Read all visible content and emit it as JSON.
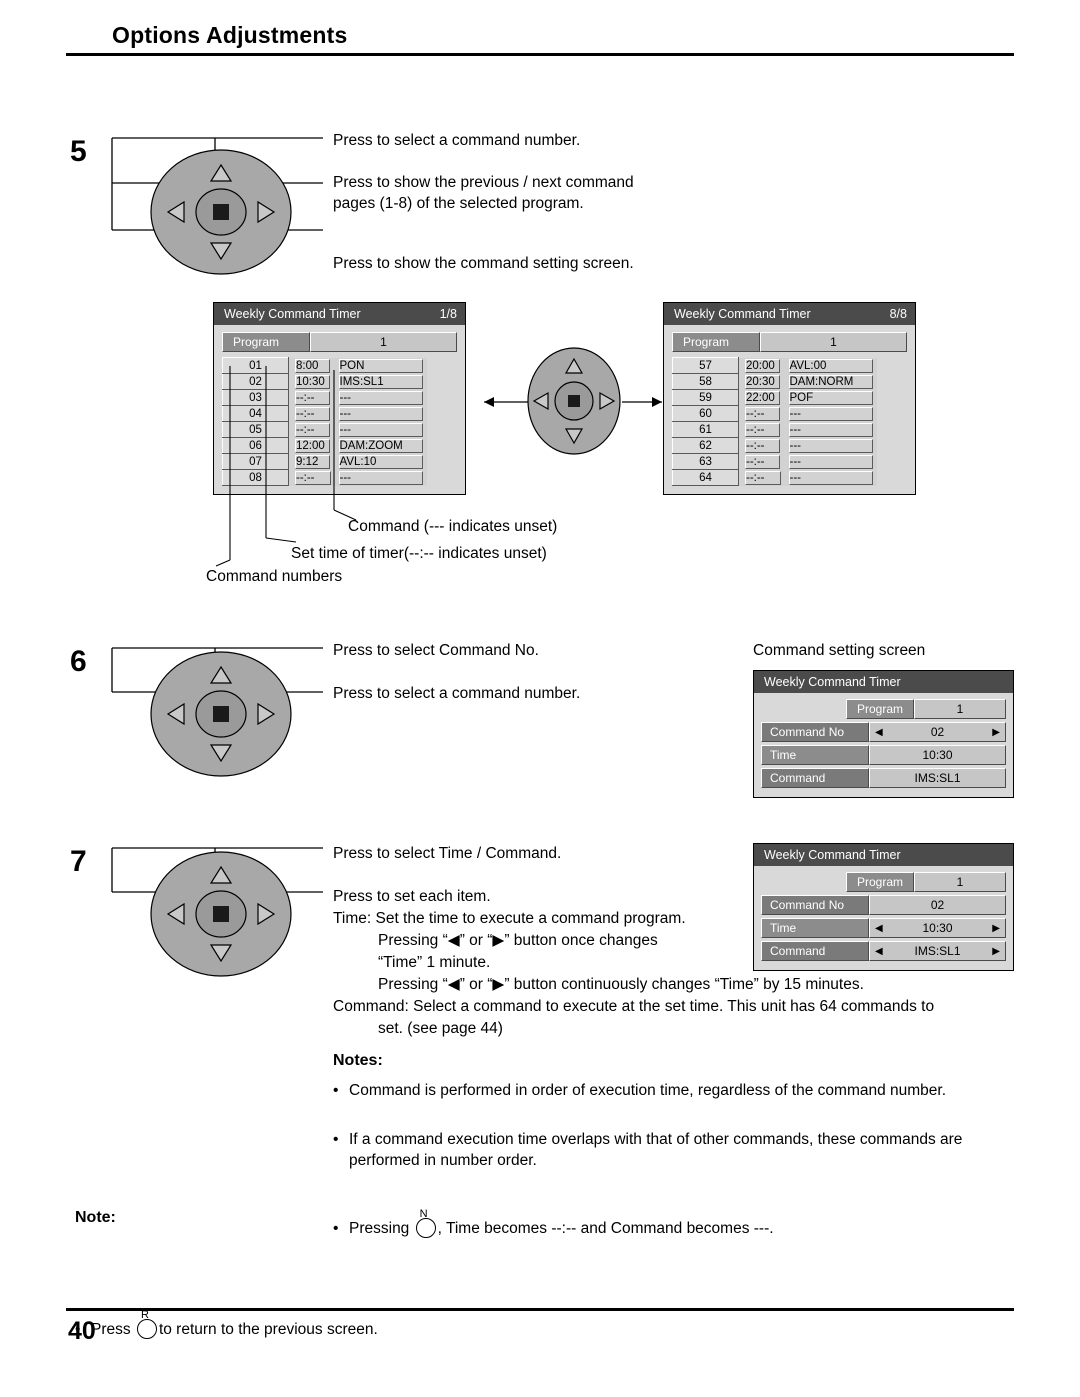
{
  "header": {
    "title": "Options Adjustments"
  },
  "footer": {
    "page_number": "40"
  },
  "steps": {
    "five": "5",
    "six": "6",
    "seven": "7"
  },
  "step5": {
    "line1": "Press to select a command number.",
    "line2": "Press to show the previous / next command",
    "line2b": "pages (1-8) of the selected program.",
    "line3": "Press to show the command setting screen.",
    "callout_command": "Command (--- indicates unset)",
    "callout_time": "Set time of timer(--:-- indicates unset)",
    "callout_numbers": "Command numbers"
  },
  "osd_page1": {
    "title": "Weekly Command Timer",
    "page": "1/8",
    "program_label": "Program",
    "program_value": "1",
    "rows": [
      {
        "no": "01",
        "time": "8:00",
        "command": "PON"
      },
      {
        "no": "02",
        "time": "10:30",
        "command": "IMS:SL1"
      },
      {
        "no": "03",
        "time": "--:--",
        "command": "---"
      },
      {
        "no": "04",
        "time": "--:--",
        "command": "---"
      },
      {
        "no": "05",
        "time": "--:--",
        "command": "---"
      },
      {
        "no": "06",
        "time": "12:00",
        "command": "DAM:ZOOM"
      },
      {
        "no": "07",
        "time": "9:12",
        "command": "AVL:10"
      },
      {
        "no": "08",
        "time": "--:--",
        "command": "---"
      }
    ]
  },
  "osd_page8": {
    "title": "Weekly Command Timer",
    "page": "8/8",
    "program_label": "Program",
    "program_value": "1",
    "rows": [
      {
        "no": "57",
        "time": "20:00",
        "command": "AVL:00"
      },
      {
        "no": "58",
        "time": "20:30",
        "command": "DAM:NORM"
      },
      {
        "no": "59",
        "time": "22:00",
        "command": "POF"
      },
      {
        "no": "60",
        "time": "--:--",
        "command": "---"
      },
      {
        "no": "61",
        "time": "--:--",
        "command": "---"
      },
      {
        "no": "62",
        "time": "--:--",
        "command": "---"
      },
      {
        "no": "63",
        "time": "--:--",
        "command": "---"
      },
      {
        "no": "64",
        "time": "--:--",
        "command": "---"
      }
    ]
  },
  "step6": {
    "line1": "Press to select Command No.",
    "line2": "Press to select a command number.",
    "screen_caption": "Command setting screen"
  },
  "osd_cmdset1": {
    "title": "Weekly Command Timer",
    "program_label": "Program",
    "program_value": "1",
    "rows": [
      {
        "label": "Command No",
        "value": "02",
        "arrows": true,
        "highlight": true
      },
      {
        "label": "Time",
        "value": "10:30",
        "arrows": false,
        "highlight": false
      },
      {
        "label": "Command",
        "value": "IMS:SL1",
        "arrows": false,
        "highlight": true
      }
    ]
  },
  "step7": {
    "line1": "Press to select Time / Command.",
    "line2": "Press to set each item.",
    "line3": "Time: Set the time to execute a command program.",
    "line4a": "Pressing “",
    "line4b": "” or “",
    "line4c": "” button once changes",
    "line5": "“Time” 1 minute.",
    "line6a": "Pressing “",
    "line6b": "” or “",
    "line6c": "” button continuously changes “Time” by 15 minutes.",
    "line7": "Command: Select a command to execute at the set time. This unit has 64 commands to",
    "line8": "set. (see page 44)"
  },
  "osd_cmdset2": {
    "title": "Weekly Command Timer",
    "program_label": "Program",
    "program_value": "1",
    "rows": [
      {
        "label": "Command No",
        "value": "02",
        "arrows": false,
        "highlight": true
      },
      {
        "label": "Time",
        "value": "10:30",
        "arrows": true,
        "highlight": false
      },
      {
        "label": "Command",
        "value": "IMS:SL1",
        "arrows": true,
        "highlight": true
      }
    ]
  },
  "notes": {
    "heading": "Notes:",
    "items": [
      "Command is performed in order of execution time, regardless of the command number.",
      "If a command execution time overlaps with that of other commands, these commands are performed in number order."
    ],
    "item3_pre": "Pressing",
    "item3_post": ", Time becomes --:-- and Command becomes ---.",
    "item3_button": "N"
  },
  "note_bottom": {
    "heading": "Note:",
    "pre": "Press",
    "post": "to return to the previous screen.",
    "button": "R"
  }
}
